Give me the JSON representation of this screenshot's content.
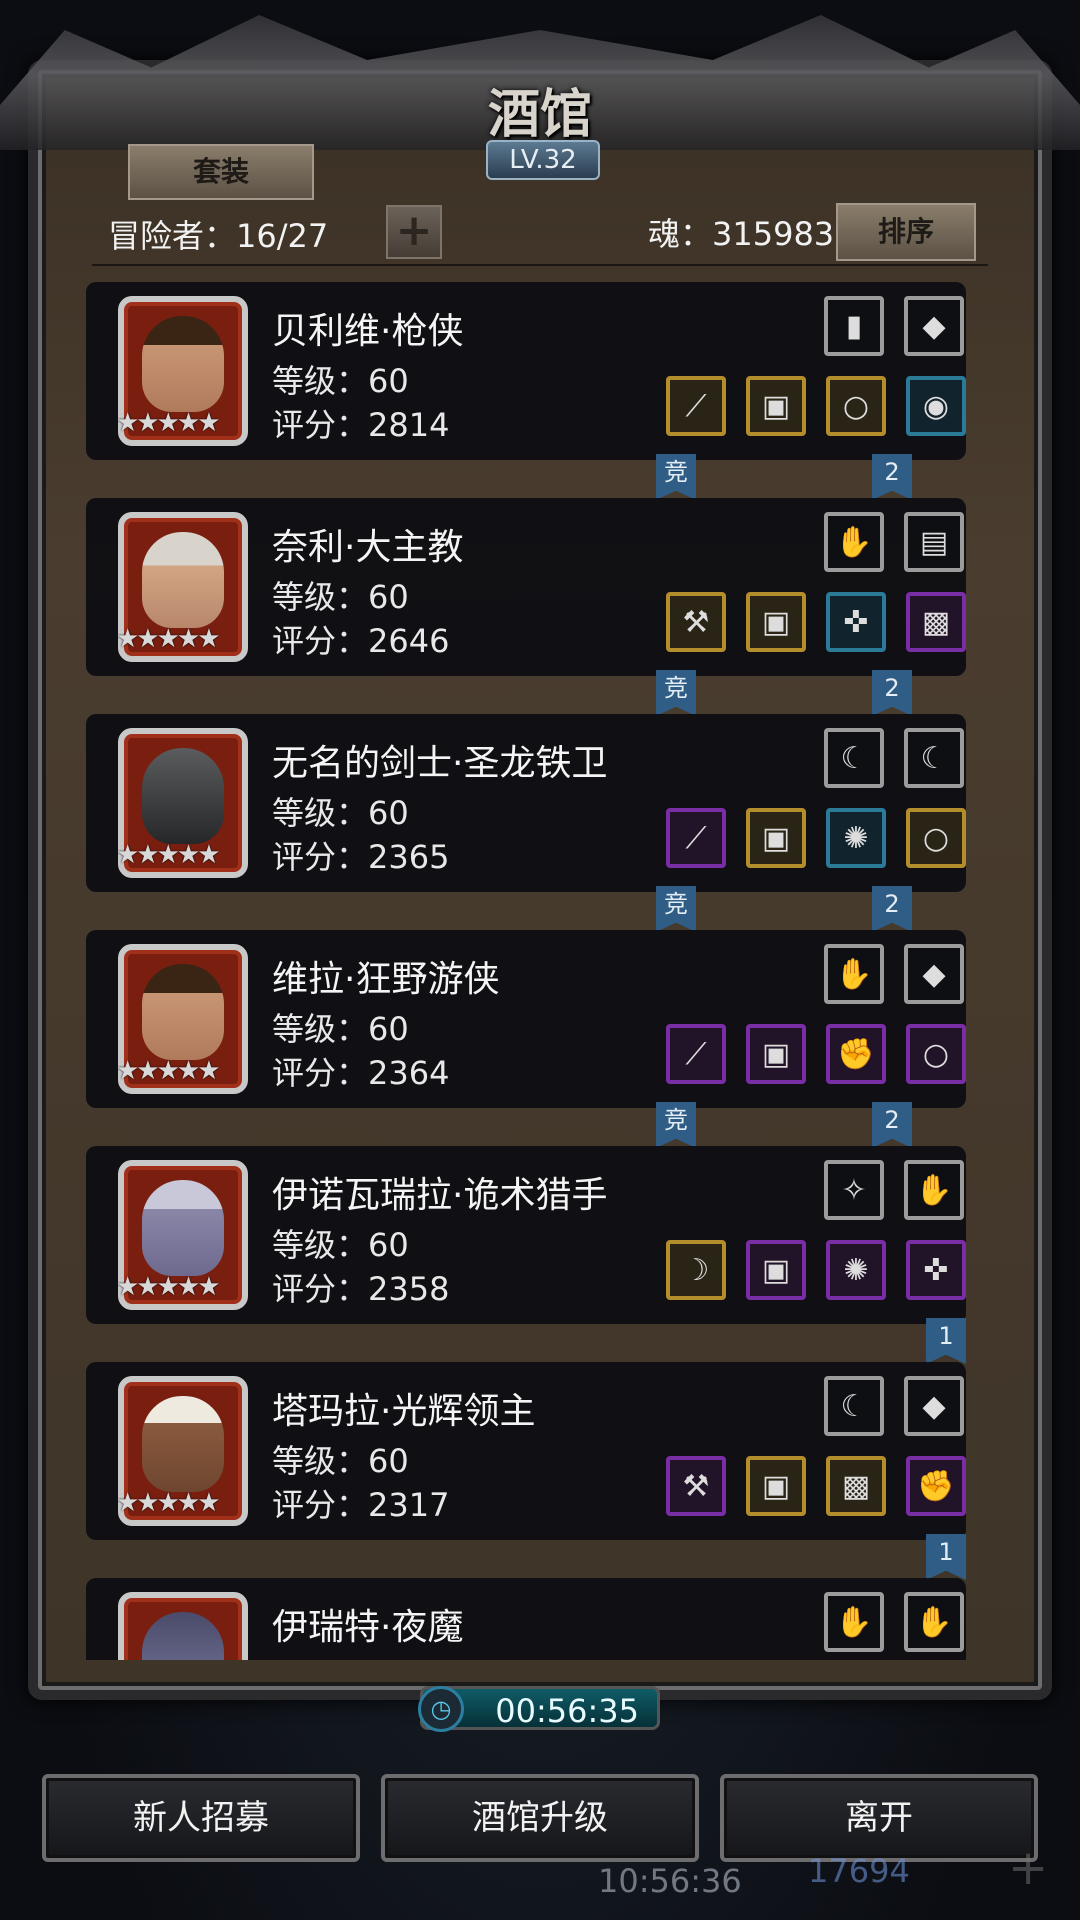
{
  "title": "酒馆",
  "level": "LV.32",
  "tab_suit": "套装",
  "adventurers": "冒险者：16/27",
  "soul": "魂：315983",
  "sort": "排序",
  "heroes": [
    {
      "name": "贝利维·枪侠",
      "level": "等级：60",
      "score": "评分：2814",
      "stars": "★★★★★",
      "ribbons": [
        "竞",
        "2"
      ]
    },
    {
      "name": "奈利·大主教",
      "level": "等级：60",
      "score": "评分：2646",
      "stars": "★★★★★",
      "ribbons": [
        "竞",
        "2"
      ]
    },
    {
      "name": "无名的剑士·圣龙铁卫",
      "level": "等级：60",
      "score": "评分：2365",
      "stars": "★★★★★",
      "ribbons": [
        "竞",
        "2"
      ]
    },
    {
      "name": "维拉·狂野游侠",
      "level": "等级：60",
      "score": "评分：2364",
      "stars": "★★★★★",
      "ribbons": [
        "竞",
        "2"
      ]
    },
    {
      "name": "伊诺瓦瑞拉·诡术猎手",
      "level": "等级：60",
      "score": "评分：2358",
      "stars": "★★★★★",
      "ribbons": [
        "1"
      ]
    },
    {
      "name": "塔玛拉·光辉领主",
      "level": "等级：60",
      "score": "评分：2317",
      "stars": "★★★★★",
      "ribbons": [
        "1"
      ]
    },
    {
      "name": "伊瑞特·夜魔",
      "level": "",
      "score": "",
      "stars": "",
      "ribbons": []
    }
  ],
  "timer": "00:56:35",
  "buttons": {
    "recruit": "新人招募",
    "upgrade": "酒馆升级",
    "leave": "离开"
  },
  "background_clock": "10:56:36",
  "background_gems": "17694",
  "colors": {
    "gold_rarity": "#b48e2a",
    "purple_rarity": "#7a2ea6",
    "blue_rarity": "#2a7a98",
    "ribbon": "#2f5d86",
    "timer": "#0f5c66"
  }
}
